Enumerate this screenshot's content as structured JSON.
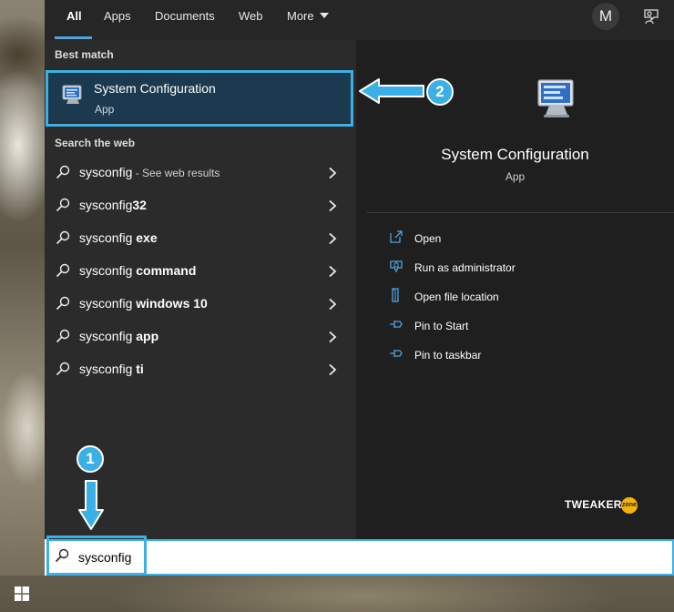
{
  "tabs": [
    {
      "label": "All",
      "active": true
    },
    {
      "label": "Apps"
    },
    {
      "label": "Documents"
    },
    {
      "label": "Web"
    },
    {
      "label": "More"
    }
  ],
  "avatar_initial": "M",
  "best_match": {
    "heading": "Best match",
    "title": "System Configuration",
    "subtitle": "App"
  },
  "web": {
    "heading": "Search the web",
    "results": [
      {
        "prefix": "sysconfig",
        "bold": "",
        "hint": " - See web results"
      },
      {
        "prefix": "sysconfig",
        "bold": "32",
        "hint": ""
      },
      {
        "prefix": "sysconfig ",
        "bold": "exe",
        "hint": ""
      },
      {
        "prefix": "sysconfig ",
        "bold": "command",
        "hint": ""
      },
      {
        "prefix": "sysconfig ",
        "bold": "windows 10",
        "hint": ""
      },
      {
        "prefix": "sysconfig ",
        "bold": "app",
        "hint": ""
      },
      {
        "prefix": "sysconfig ",
        "bold": "ti",
        "hint": ""
      }
    ]
  },
  "detail": {
    "title": "System Configuration",
    "subtitle": "App",
    "actions": [
      {
        "label": "Open",
        "icon": "open-icon"
      },
      {
        "label": "Run as administrator",
        "icon": "shield-icon"
      },
      {
        "label": "Open file location",
        "icon": "folder-icon"
      },
      {
        "label": "Pin to Start",
        "icon": "pin-icon"
      },
      {
        "label": "Pin to taskbar",
        "icon": "pin-icon"
      }
    ]
  },
  "brand": {
    "name": "TWEAKER",
    "badge": "zone"
  },
  "search": {
    "value": "sysconfig"
  },
  "annotations": {
    "step1": "1",
    "step2": "2"
  },
  "colors": {
    "accent": "#3ab0e6",
    "selected_bg": "#1b3a4f"
  }
}
